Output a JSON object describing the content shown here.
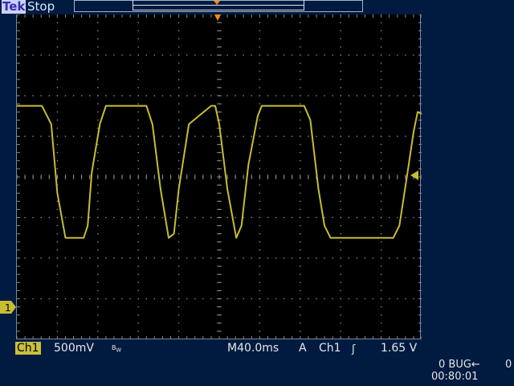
{
  "header": {
    "brand": "Tek",
    "acq_state": "Stop"
  },
  "colors": {
    "trace": "#c6bd33",
    "trigger_marker": "#ff8a00",
    "grid": "#8a8a8a",
    "panel": "#001a40"
  },
  "scope": {
    "channel_label": "Ch1",
    "volts_per_div": "500mV",
    "bandwidth_limit": "B",
    "bandwidth_sub": "W",
    "timebase": "M40.0ms",
    "trigger_mode": "A",
    "trigger_source": "Ch1",
    "trigger_level": "1.65 V",
    "ground_marker": "1",
    "status_line": "0 BUG←",
    "status_count": "0",
    "clock": "00:80:01"
  },
  "chart_data": {
    "type": "line",
    "title": "",
    "xlabel": "",
    "ylabel": "",
    "x_unit_per_div": "40.0ms",
    "y_unit_per_div": "500mV",
    "xlim_div": [
      0,
      10
    ],
    "ylim_div": [
      -4,
      4
    ],
    "grid": true,
    "series": [
      {
        "x_div": [
          0,
          0.62,
          0.85,
          1.0,
          1.2,
          1.65,
          1.75,
          1.85,
          2.05,
          2.2,
          3.2,
          3.35,
          3.55,
          3.75,
          3.88,
          4.0,
          4.25,
          4.8,
          4.9,
          5.0,
          5.2,
          5.42,
          5.55,
          5.72,
          5.95,
          6.05,
          7.1,
          7.25,
          7.45,
          7.6,
          7.75,
          8.0,
          8.5,
          9.3,
          9.45,
          9.65,
          9.8,
          9.9,
          10.0
        ],
        "y_div": [
          1.75,
          1.75,
          1.3,
          -0.4,
          -1.5,
          -1.5,
          -1.2,
          0.1,
          1.3,
          1.75,
          1.75,
          1.3,
          -0.3,
          -1.5,
          -1.4,
          -0.3,
          1.3,
          1.75,
          1.75,
          1.3,
          -0.3,
          -1.5,
          -1.2,
          0.3,
          1.5,
          1.75,
          1.75,
          1.4,
          -0.3,
          -1.2,
          -1.5,
          -1.5,
          -1.5,
          -1.5,
          -1.2,
          0.1,
          1.1,
          1.6,
          1.55
        ]
      }
    ]
  }
}
